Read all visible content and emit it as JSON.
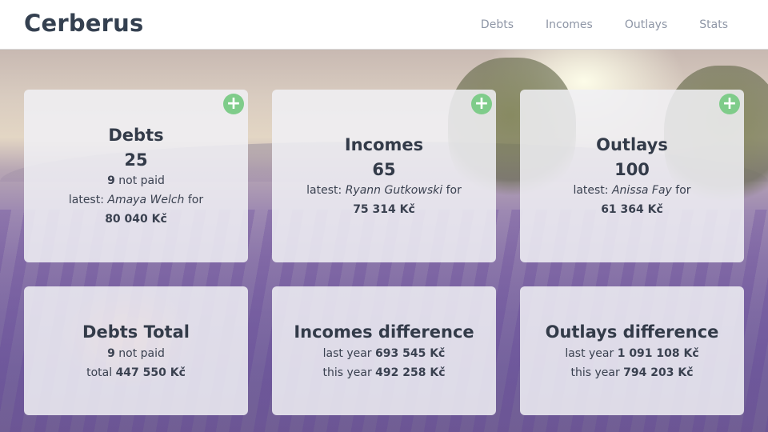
{
  "app": {
    "brand": "Cerberus"
  },
  "nav": {
    "items": [
      {
        "label": "Debts"
      },
      {
        "label": "Incomes"
      },
      {
        "label": "Outlays"
      },
      {
        "label": "Stats"
      }
    ]
  },
  "cards": {
    "debts": {
      "title": "Debts",
      "count": "25",
      "not_paid_count": "9",
      "not_paid_label": "not paid",
      "latest_prefix": "latest:",
      "latest_name": "Amaya Welch",
      "latest_for": "for",
      "latest_amount": "80 040 Kč",
      "add_symbol": "+"
    },
    "incomes": {
      "title": "Incomes",
      "count": "65",
      "latest_prefix": "latest:",
      "latest_name": "Ryann Gutkowski",
      "latest_for": "for",
      "latest_amount": "75 314 Kč",
      "add_symbol": "+"
    },
    "outlays": {
      "title": "Outlays",
      "count": "100",
      "latest_prefix": "latest:",
      "latest_name": "Anissa Fay",
      "latest_for": "for",
      "latest_amount": "61 364 Kč",
      "add_symbol": "+"
    },
    "debts_total": {
      "title": "Debts Total",
      "not_paid_count": "9",
      "not_paid_label": "not paid",
      "total_label": "total",
      "total_amount": "447 550 Kč"
    },
    "incomes_difference": {
      "title": "Incomes difference",
      "last_year_label": "last year",
      "last_year_amount": "693 545 Kč",
      "this_year_label": "this year",
      "this_year_amount": "492 258 Kč"
    },
    "outlays_difference": {
      "title": "Outlays difference",
      "last_year_label": "last year",
      "last_year_amount": "1 091 108 Kč",
      "this_year_label": "this year",
      "this_year_amount": "794 203 Kč"
    }
  },
  "colors": {
    "add_button": "#7fcc8a",
    "nav_link": "#8e96a6",
    "brand": "#344050"
  },
  "icons": {
    "add": "plus-icon"
  }
}
